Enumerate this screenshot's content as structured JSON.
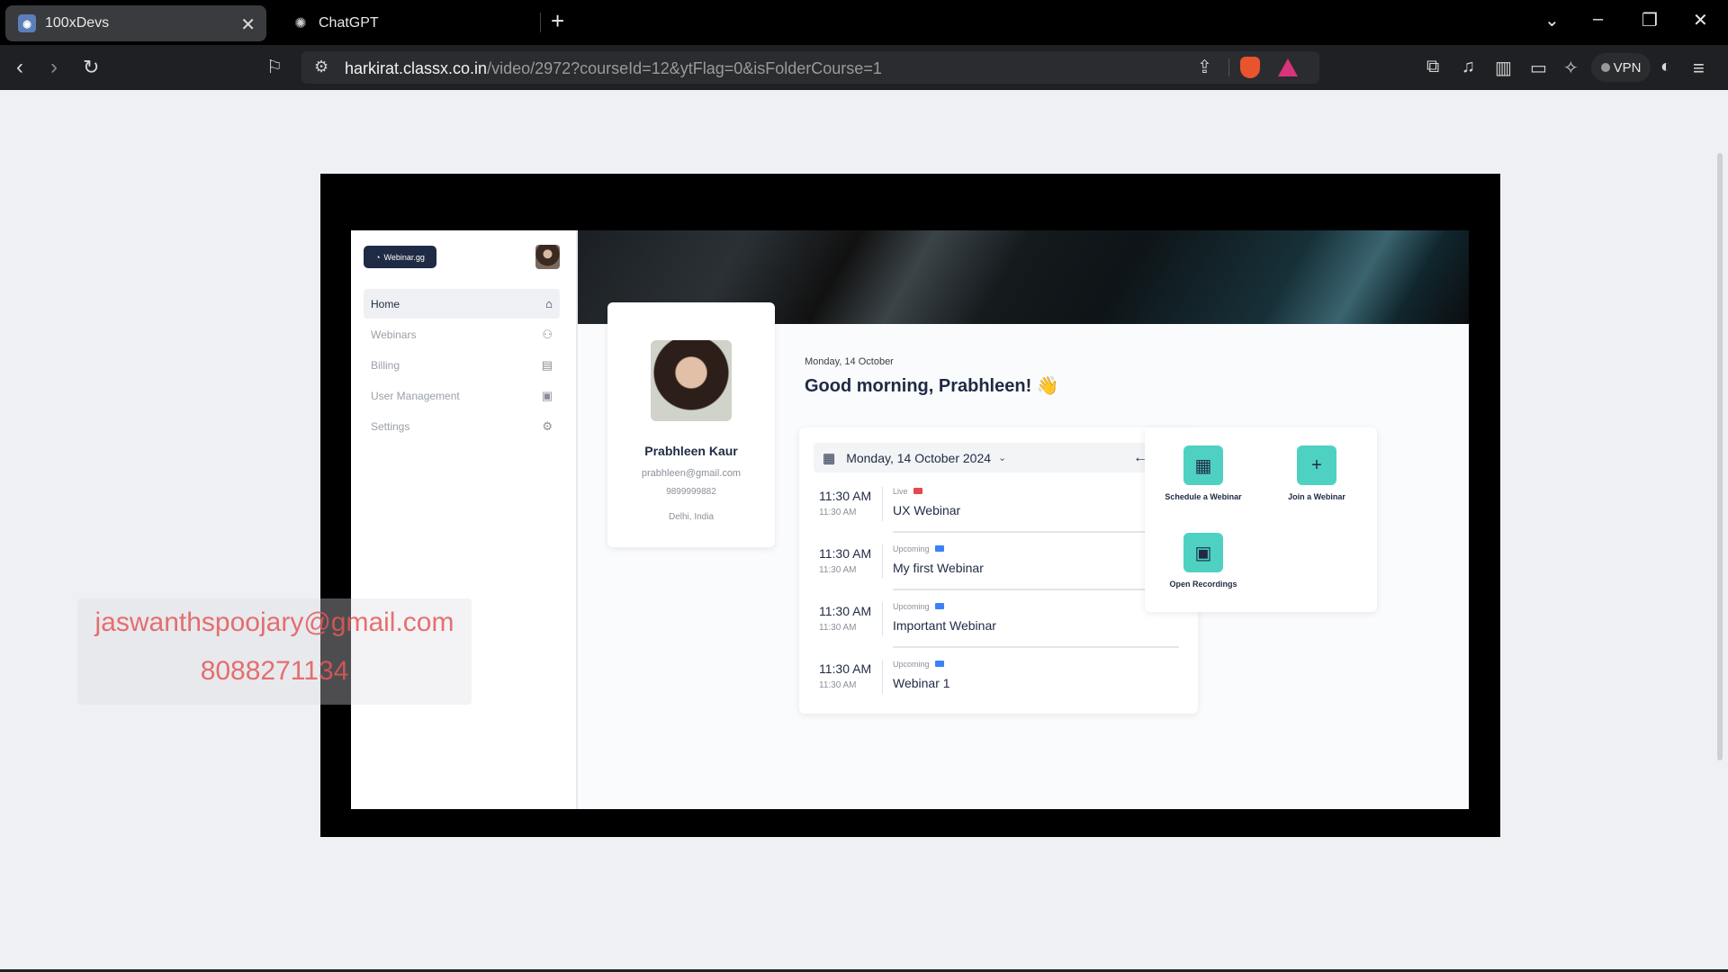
{
  "browser": {
    "tabs": [
      {
        "title": "100xDevs",
        "active": true
      },
      {
        "title": "ChatGPT",
        "active": false
      }
    ],
    "url_host": "harkirat.classx.co.in",
    "url_path": "/video/2972?courseId=12&ytFlag=0&isFolderCourse=1",
    "vpn_label": "VPN"
  },
  "app": {
    "logo_text": "Webinar.gg",
    "nav": [
      {
        "label": "Home",
        "icon": "home-icon",
        "active": true
      },
      {
        "label": "Webinars",
        "icon": "users-icon",
        "active": false
      },
      {
        "label": "Billing",
        "icon": "card-icon",
        "active": false
      },
      {
        "label": "User Management",
        "icon": "user-card-icon",
        "active": false
      },
      {
        "label": "Settings",
        "icon": "settings-icon",
        "active": false
      }
    ],
    "profile": {
      "name": "Prabhleen Kaur",
      "email": "prabhleen@gmail.com",
      "phone": "9899999882",
      "location": "Delhi, India"
    },
    "date_small": "Monday, 14 October",
    "greeting": "Good morning, Prabhleen! 👋",
    "schedule": {
      "date_label": "Monday, 14 October 2024",
      "events": [
        {
          "time": "11:30 AM",
          "time_sub": "11:30 AM",
          "status": "Live",
          "status_color": "#e5484d",
          "title": "UX Webinar"
        },
        {
          "time": "11:30 AM",
          "time_sub": "11:30 AM",
          "status": "Upcoming",
          "status_color": "#3b82f6",
          "title": "My first Webinar"
        },
        {
          "time": "11:30 AM",
          "time_sub": "11:30 AM",
          "status": "Upcoming",
          "status_color": "#3b82f6",
          "title": "Important Webinar"
        },
        {
          "time": "11:30 AM",
          "time_sub": "11:30 AM",
          "status": "Upcoming",
          "status_color": "#3b82f6",
          "title": "Webinar 1"
        }
      ]
    },
    "actions": [
      {
        "label": "Schedule a Webinar",
        "icon": "calendar-icon"
      },
      {
        "label": "Join a Webinar",
        "icon": "plus-icon"
      },
      {
        "label": "Open Recordings",
        "icon": "recordings-icon"
      }
    ]
  },
  "watermark": {
    "email": "jaswanthspoojary@gmail.com",
    "phone": "8088271134"
  },
  "colors": {
    "accent": "#4fd1c1",
    "navy": "#1f2a44",
    "live": "#e5484d",
    "upcoming": "#3b82f6"
  }
}
